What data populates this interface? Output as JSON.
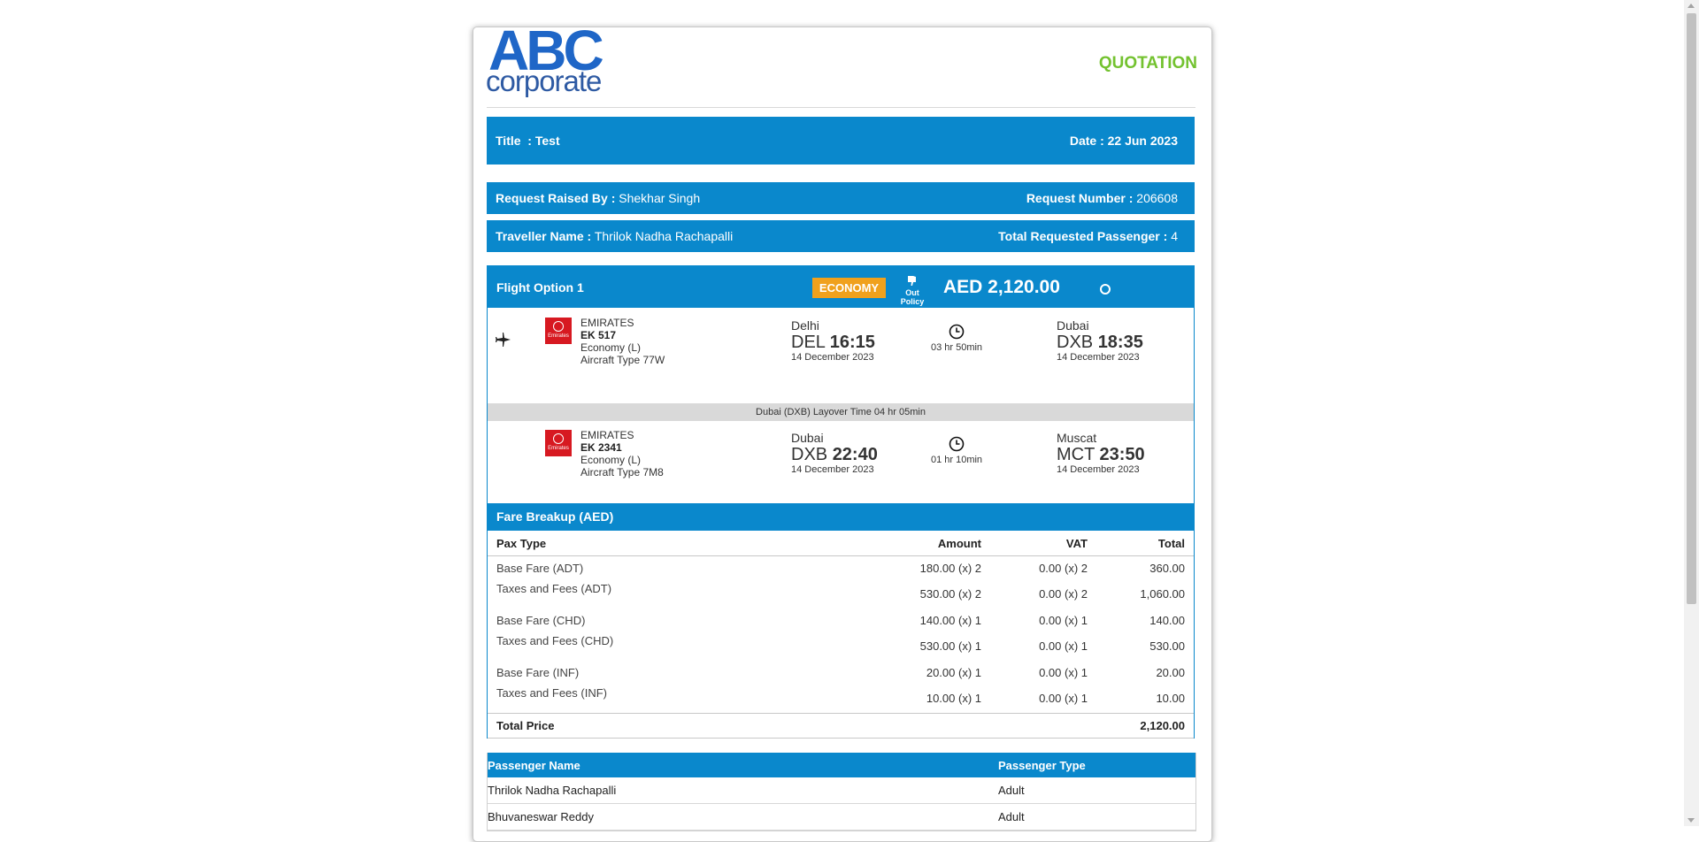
{
  "logo": {
    "line1": "ABC",
    "line2": "corporate"
  },
  "doc_type": "QUOTATION",
  "header": {
    "title": "Title  : Test",
    "date": "Date : 22 Jun 2023"
  },
  "request": {
    "raised_label": "Request Raised By :",
    "raised_value": "Shekhar Singh",
    "number_label": "Request Number :",
    "number_value": "206608"
  },
  "traveller": {
    "name_label": "Traveller Name :",
    "name_value": "Thrilok Nadha Rachapalli",
    "pass_label": "Total Requested Passenger :",
    "pass_value": "4"
  },
  "flight_option": {
    "title": "Flight Option 1",
    "cabin_badge": "ECONOMY",
    "policy": "Out Policy",
    "price": "AED 2,120.00",
    "segments": [
      {
        "airline": "EMIRATES",
        "flight_no": "EK 517",
        "class": "Economy (L)",
        "aircraft": "Aircraft Type 77W",
        "logo_text": "Emirates",
        "dep_city": "Delhi",
        "dep_code": "DEL",
        "dep_time": "16:15",
        "dep_date": "14 December 2023",
        "duration": "03 hr 50min",
        "arr_city": "Dubai",
        "arr_code": "DXB",
        "arr_time": "18:35",
        "arr_date": "14 December 2023"
      },
      {
        "airline": "EMIRATES",
        "flight_no": "EK 2341",
        "class": "Economy (L)",
        "aircraft": "Aircraft Type 7M8",
        "logo_text": "Emirates",
        "dep_city": "Dubai",
        "dep_code": "DXB",
        "dep_time": "22:40",
        "dep_date": "14 December 2023",
        "duration": "01 hr 10min",
        "arr_city": "Muscat",
        "arr_code": "MCT",
        "arr_time": "23:50",
        "arr_date": "14 December 2023"
      }
    ],
    "layover": "Dubai (DXB) Layover Time 04 hr 05min"
  },
  "fare": {
    "title": "Fare Breakup (AED)",
    "headers": [
      "Pax Type",
      "Amount",
      "VAT",
      "Total"
    ],
    "groups": [
      {
        "rows": [
          [
            "Base Fare (ADT)",
            "180.00 (x) 2",
            "0.00 (x) 2",
            "360.00"
          ],
          [
            "Taxes and Fees (ADT)",
            "530.00 (x) 2",
            "0.00 (x) 2",
            "1,060.00"
          ]
        ]
      },
      {
        "rows": [
          [
            "Base Fare (CHD)",
            "140.00 (x) 1",
            "0.00 (x) 1",
            "140.00"
          ],
          [
            "Taxes and Fees (CHD)",
            "530.00 (x) 1",
            "0.00 (x) 1",
            "530.00"
          ]
        ]
      },
      {
        "rows": [
          [
            "Base Fare (INF)",
            "20.00 (x) 1",
            "0.00 (x) 1",
            "20.00"
          ],
          [
            "Taxes and Fees (INF)",
            "10.00 (x) 1",
            "0.00 (x) 1",
            "10.00"
          ]
        ]
      }
    ],
    "total_label": "Total Price",
    "total_value": "2,120.00"
  },
  "passengers": {
    "headers": [
      "Passenger Name",
      "Passenger Type"
    ],
    "rows": [
      [
        "Thrilok Nadha Rachapalli",
        "Adult"
      ],
      [
        "Bhuvaneswar Reddy",
        "Adult"
      ]
    ]
  },
  "colors": {
    "header_blue": "#0a88cc",
    "badge_orange": "#f0a11d",
    "quotation_green": "#73c22f",
    "logo_blue": "#1f66c7",
    "emirates_red": "#d71921",
    "layover_gray": "#d9d9d9"
  }
}
